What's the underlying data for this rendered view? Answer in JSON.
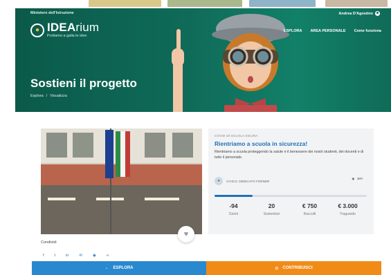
{
  "header": {
    "ministry": "Ministero dell'Istruzione",
    "user_name": "Andrea D'Agostino",
    "logo": {
      "name_bold": "IDEA",
      "name_light": "rium",
      "tagline": "Portiamo a galla le idee"
    },
    "nav": [
      "ESPLORA",
      "AREA PERSONALE",
      "Come funziona"
    ]
  },
  "hero": {
    "title": "Sostieni il progetto",
    "breadcrumb": [
      "Esplora",
      "/",
      "Visualizza"
    ]
  },
  "project": {
    "category": "COVID-19 SCUOLA SICURA",
    "title": "Rientriamo a scuola in sicurezza!",
    "description": "Rientriamo a scuola proteggendo la salute e il benessere dei nostri studenti, dei docenti e di tutto il personale.",
    "school": "CIVICO. DEDICATO FORNER",
    "location": "BRI",
    "progress": 0.25,
    "stats": [
      {
        "value": "-94",
        "label": "Giorni"
      },
      {
        "value": "20",
        "label": "Sostenitori"
      },
      {
        "value": "€ 750",
        "label": "Raccolti"
      },
      {
        "value": "€ 3.000",
        "label": "Traguardo"
      }
    ]
  },
  "share": {
    "label": "Condividi",
    "icons": [
      "facebook-icon",
      "twitter-icon",
      "linkedin-icon",
      "email-icon",
      "messenger-icon",
      "link-icon"
    ],
    "glyphs": [
      "f",
      "t",
      "in",
      "✉",
      "◉",
      "∞"
    ]
  },
  "buttons": {
    "explore": "ESPLORA",
    "explore_icon": "←",
    "contribute": "CONTRIBUISCI",
    "contribute_icon": "⊙"
  },
  "colors": {
    "hero_bg": "#0f6a58",
    "accent_blue": "#1f6fb8",
    "button_blue": "#2a88cf",
    "button_orange": "#f08b17"
  }
}
